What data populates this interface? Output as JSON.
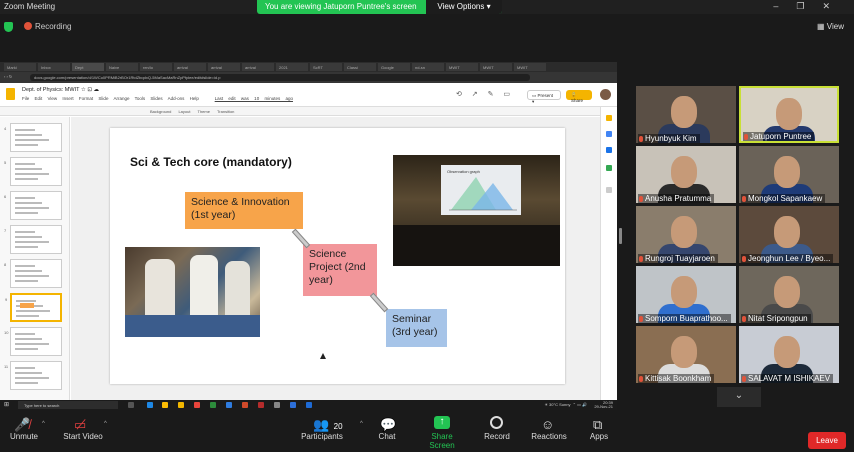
{
  "app": {
    "title": "Zoom Meeting"
  },
  "banner": {
    "viewing": "You are viewing Jatuporn Puntree's screen",
    "view_options": "View Options ▾"
  },
  "status": {
    "recording": "Recording",
    "view": "View"
  },
  "browser": {
    "tabs": [
      "Marki",
      "Inbox",
      "Dept",
      "Naive",
      "ren/lo",
      "arrival",
      "arrival",
      "arrival",
      "2021",
      "ScRT",
      "Classi",
      "Google",
      "nd-sn",
      "MWIT",
      "MWIT",
      "MWIT"
    ],
    "url": "docs.google.com/presentation/d/1WCo0PRMiB2rBOr1RtdZbqdxQ-5MaSacMaRnZpPfplee/edit#slide=id.p"
  },
  "slides_app": {
    "doc_title": "Dept. of Physics: MWIT",
    "menus": "File  Edit  View  Insert  Format  Slide  Arrange  Tools  Slides  Add-ons  Help",
    "last_edit": "Last edit was 10 minutes ago",
    "present": "Present",
    "share": "Share",
    "toolbar": "Background  Layout  Theme  Transition",
    "thumb_numbers": [
      "4",
      "5",
      "6",
      "7",
      "8",
      "9",
      "10",
      "11"
    ]
  },
  "slide": {
    "title": "Sci & Tech core (mandatory)",
    "box1": "Science & Innovation (1st year)",
    "box2": "Science Project (2nd year)",
    "box3": "Seminar (3rd year)",
    "screen_caption": "Observation graph"
  },
  "taskbar": {
    "search": "Type here to search",
    "weather": "30°C  Sunny",
    "time": "20:39",
    "date": "29-Nov-21"
  },
  "participants": [
    {
      "name": "Hyunbyuk Kim",
      "shirt": "#2b3a5c",
      "bg": "#5a4f45",
      "active": false
    },
    {
      "name": "Jatuporn Puntree",
      "shirt": "#243a6e",
      "bg": "#d8d2c4",
      "active": true
    },
    {
      "name": "Anusha Pratumma",
      "shirt": "#2a2a2a",
      "bg": "#c8c2b8",
      "active": false
    },
    {
      "name": "Mongkol Sapankaew",
      "shirt": "#1e3b78",
      "bg": "#6a6258",
      "active": false
    },
    {
      "name": "Rungroj Tuayjaroen",
      "shirt": "#35466e",
      "bg": "#8a7d6c",
      "active": false
    },
    {
      "name": "Jeonghun Lee / Byeo...",
      "shirt": "#3c5a8a",
      "bg": "#5c4a3c",
      "active": false
    },
    {
      "name": "Somporn Buaprathoo...",
      "shirt": "#2f6fcf",
      "bg": "#bfc4c8",
      "active": false
    },
    {
      "name": "Nitat Sripongpun",
      "shirt": "#4a4a4a",
      "bg": "#6e675c",
      "active": false
    },
    {
      "name": "Kittisak Boonkham",
      "shirt": "#dcdcdc",
      "bg": "#8a6e52",
      "active": false
    },
    {
      "name": "SALAVAT M ISHIKAEV",
      "shirt": "#1d2a3a",
      "bg": "#c8ccd4",
      "active": false
    }
  ],
  "controls": {
    "unmute": "Unmute",
    "start_video": "Start Video",
    "participants": "Participants",
    "participant_count": "20",
    "chat": "Chat",
    "share_screen": "Share Screen",
    "record": "Record",
    "reactions": "Reactions",
    "apps": "Apps",
    "leave": "Leave"
  },
  "colors": {
    "zoom_green": "#23c453",
    "leave_red": "#e02828",
    "active_border": "#c9e036",
    "slides_yellow": "#f4b400"
  }
}
